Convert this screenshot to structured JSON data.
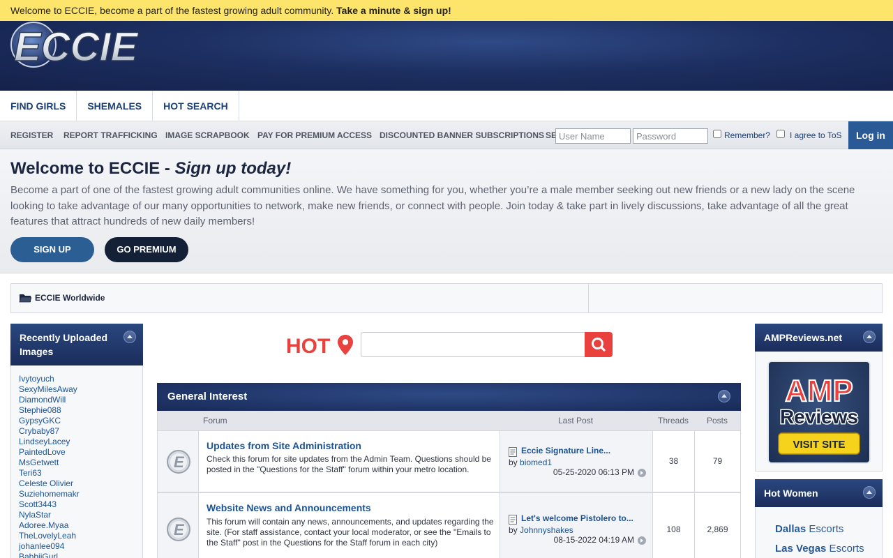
{
  "notice": {
    "text": "Welcome to ECCIE, become a part of the fastest growing adult community. ",
    "link": "Take a minute & sign up!"
  },
  "logo": {
    "text": "ECCIE"
  },
  "main_nav": [
    "FIND GIRLS",
    "SHEMALES",
    "HOT SEARCH"
  ],
  "sub_nav": [
    "REGISTER",
    "REPORT TRAFFICKING",
    "IMAGE SCRAPBOOK",
    "PAY FOR PREMIUM ACCESS",
    "DISCOUNTED BANNER SUBSCRIPTIONS",
    "SE"
  ],
  "login": {
    "username_placeholder": "User Name",
    "password_placeholder": "Password",
    "remember_label": "Remember?",
    "tos_label": "I agree to ToS",
    "button": "Log in"
  },
  "welcome": {
    "title": "Welcome to ECCIE - ",
    "title_em": "Sign up today!",
    "body": "Become a part of one of the fastest growing adult communities online. We have something for you, whether you’re a male member seeking out new friends or a new lady on the scene looking to take advantage of our many opportunities to network, make new friends, or connect with people. Join today & take part in lively discussions, take advantage of all the great features that attract hundreds of new daily members!",
    "signup_button": "SIGN UP",
    "premium_button": "GO PREMIUM"
  },
  "breadcrumb": "ECCIE Worldwide",
  "recent_images": {
    "title": "Recently Uploaded Images",
    "users": [
      "Ivytoyuch",
      "SexyMilesAway",
      "DiamondWill",
      "Stephie088",
      "GypsyGKC",
      "Crybaby87",
      "LindseyLacey",
      "PaintedLove",
      "MsGetwett",
      "Teri63",
      "Celeste Olivier",
      "Suziehomemakr",
      "Scott3443",
      "NylaStar",
      "Adoree.Myaa",
      "TheLovelyLeah",
      "johanlee094",
      "BabbiiGurl"
    ]
  },
  "hot_search": {
    "logo_text": "HOT",
    "placeholder": ""
  },
  "forum": {
    "section_title": "General Interest",
    "columns": {
      "forum": "Forum",
      "last_post": "Last Post",
      "threads": "Threads",
      "posts": "Posts"
    },
    "rows": [
      {
        "title": "Updates from Site Administration",
        "description": "Check this forum for site updates from the Admin Team. Questions should be posted in the \"Questions for the Staff\" forum within your metro location.",
        "last_post_title": "Eccie Signature Line...",
        "by_label": "by",
        "last_post_user": "biomed1",
        "last_post_date": "05-25-2020",
        "last_post_time": "06:13 PM",
        "threads": "38",
        "posts": "79"
      },
      {
        "title": "Website News and Announcements",
        "description": "This forum will contain any news, announcements, and updates regarding the site. (For staff assistance, contact your local moderator, or see the \"Emails to the Staff\" post in the Questions for the Staff forum in each city)",
        "last_post_title": "Let's welcome Pistolero to...",
        "by_label": "by",
        "last_post_user": "Johnnyshakes",
        "last_post_date": "08-15-2022",
        "last_post_time": "04:19 AM",
        "threads": "108",
        "posts": "2,869"
      }
    ]
  },
  "amp": {
    "title": "AMPReviews.net",
    "ad_line1": "AMP",
    "ad_line2": "Reviews",
    "ad_button": "VISIT SITE"
  },
  "hot_women": {
    "title": "Hot Women",
    "links": [
      {
        "city": "Dallas",
        "suffix": " Escorts"
      },
      {
        "city": "Las Vegas",
        "suffix": " Escorts"
      }
    ]
  },
  "colors": {
    "notice_bg": "#fde56b",
    "header_navy": "#1d2f61",
    "link_blue": "#1b5394",
    "hot_red": "#e8413e"
  }
}
